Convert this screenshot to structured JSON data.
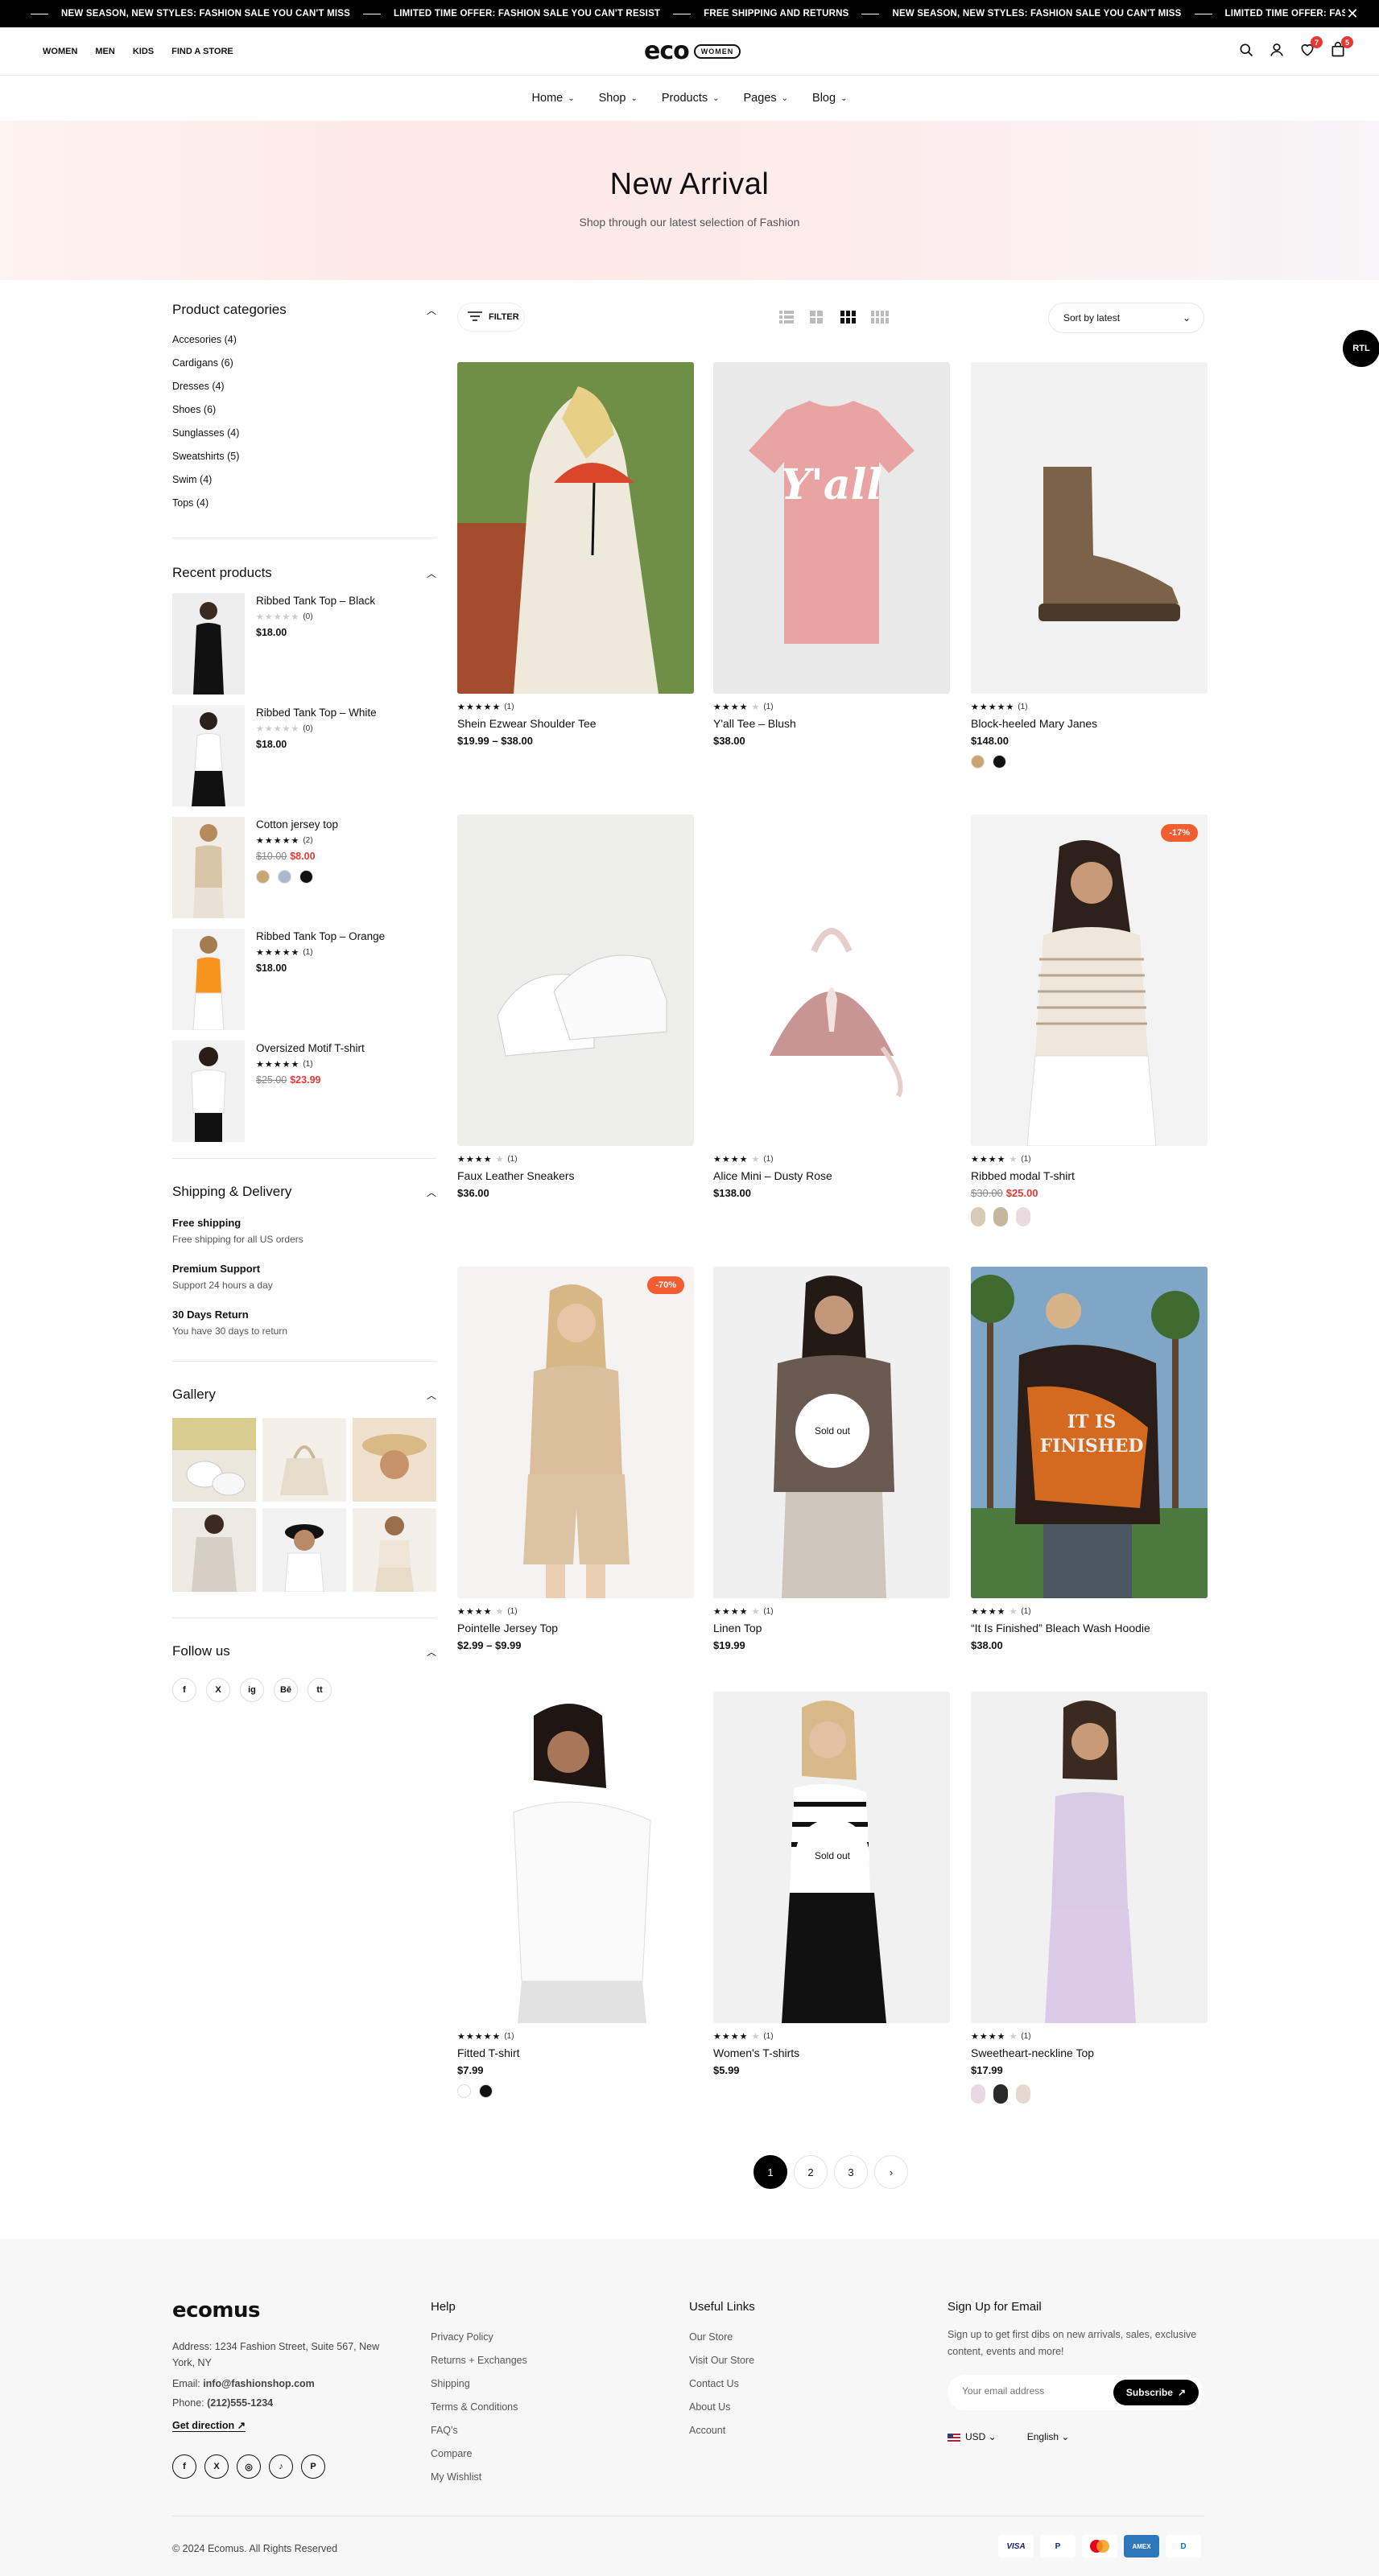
{
  "announcement": {
    "items": [
      "NEW SEASON, NEW STYLES: FASHION SALE YOU CAN'T MISS",
      "LIMITED TIME OFFER: FASHION SALE YOU CAN'T RESIST",
      "FREE SHIPPING AND RETURNS",
      "NEW SEASON, NEW STYLES: FASHION SALE YOU CAN'T MISS",
      "LIMITED TIME OFFER: FASH"
    ]
  },
  "header": {
    "left_links": [
      "WOMEN",
      "MEN",
      "KIDS",
      "FIND A STORE"
    ],
    "logo_text": "eco",
    "logo_pill": "WOMEN",
    "wishlist_count": "7",
    "cart_count": "5"
  },
  "nav": [
    "Home",
    "Shop",
    "Products",
    "Pages",
    "Blog"
  ],
  "hero": {
    "title": "New Arrival",
    "subtitle": "Shop through our latest selection of Fashion"
  },
  "sidebar": {
    "categories_title": "Product categories",
    "categories": [
      "Accesories (4)",
      "Cardigans (6)",
      "Dresses (4)",
      "Shoes (6)",
      "Sunglasses (4)",
      "Sweatshirts (5)",
      "Swim (4)",
      "Tops (4)"
    ],
    "recent_title": "Recent products",
    "recent": [
      {
        "name": "Ribbed Tank Top – Black",
        "count": "(0)",
        "price": "$18.00",
        "rating": 0
      },
      {
        "name": "Ribbed Tank Top – White",
        "count": "(0)",
        "price": "$18.00",
        "rating": 0
      },
      {
        "name": "Cotton jersey top",
        "count": "(2)",
        "old": "$10.00",
        "price": "$8.00",
        "rating": 5
      },
      {
        "name": "Ribbed Tank Top – Orange",
        "count": "(1)",
        "price": "$18.00",
        "rating": 5
      },
      {
        "name": "Oversized Motif T-shirt",
        "count": "(1)",
        "old": "$25.00",
        "price": "$23.99",
        "rating": 5
      }
    ],
    "shipping_title": "Shipping & Delivery",
    "shipping": [
      {
        "title": "Free shipping",
        "desc": "Free shipping for all US orders"
      },
      {
        "title": "Premium Support",
        "desc": "Support 24 hours a day"
      },
      {
        "title": "30 Days Return",
        "desc": "You have 30 days to return"
      }
    ],
    "gallery_title": "Gallery",
    "follow_title": "Follow us",
    "social": [
      "f",
      "X",
      "ig",
      "Bē",
      "tt"
    ]
  },
  "toolbar": {
    "filter_label": "FILTER",
    "sort_label": "Sort by latest",
    "rtl_label": "RTL"
  },
  "products": [
    {
      "name": "Shein Ezwear Shoulder Tee",
      "price": "$19.99 – $38.00",
      "count": "(1)",
      "rating": 5
    },
    {
      "name": "Y'all Tee – Blush",
      "price": "$38.00",
      "count": "(1)",
      "rating": 4
    },
    {
      "name": "Block-heeled Mary Janes",
      "price": "$148.00",
      "count": "(1)",
      "rating": 5
    },
    {
      "name": "Faux Leather Sneakers",
      "price": "$36.00",
      "count": "(1)",
      "rating": 4
    },
    {
      "name": "Alice Mini – Dusty Rose",
      "price": "$138.00",
      "count": "(1)",
      "rating": 4
    },
    {
      "name": "Ribbed modal T-shirt",
      "old": "$30.00",
      "price": "$25.00",
      "count": "(1)",
      "rating": 4,
      "badge": "-17%"
    },
    {
      "name": "Pointelle Jersey Top",
      "price": "$2.99 – $9.99",
      "count": "(1)",
      "rating": 4,
      "badge": "-70%"
    },
    {
      "name": "Linen Top",
      "price": "$19.99",
      "count": "(1)",
      "rating": 4,
      "soldout": "Sold out"
    },
    {
      "name": "“It Is Finished” Bleach Wash Hoodie",
      "price": "$38.00",
      "count": "(1)",
      "rating": 4
    },
    {
      "name": "Fitted T-shirt",
      "price": "$7.99",
      "count": "(1)",
      "rating": 5
    },
    {
      "name": "Women's T-shirts",
      "price": "$5.99",
      "count": "(1)",
      "rating": 4,
      "soldout": "Sold out"
    },
    {
      "name": "Sweetheart-neckline Top",
      "price": "$17.99",
      "count": "(1)",
      "rating": 4
    }
  ],
  "pagination": [
    "1",
    "2",
    "3",
    "›"
  ],
  "footer": {
    "logo": "ecomus",
    "address": "Address: 1234 Fashion Street, Suite 567, New York, NY",
    "email_label": "Email: ",
    "email": "info@fashionshop.com",
    "phone_label": "Phone: ",
    "phone": "(212)555-1234",
    "direction": "Get direction",
    "help_title": "Help",
    "help": [
      "Privacy Policy",
      "Returns + Exchanges",
      "Shipping",
      "Terms & Conditions",
      "FAQ's",
      "Compare",
      "My Wishlist"
    ],
    "links_title": "Useful Links",
    "links": [
      "Our Store",
      "Visit Our Store",
      "Contact Us",
      "About Us",
      "Account"
    ],
    "signup_title": "Sign Up for Email",
    "signup_text": "Sign up to get first dibs on new arrivals, sales, exclusive content, events and more!",
    "email_placeholder": "Your email address",
    "subscribe": "Subscribe",
    "currency": "USD",
    "language": "English",
    "copyright": "© 2024 Ecomus. All Rights Reserved",
    "payments": [
      "VISA",
      "P",
      "MC",
      "AMEX",
      "D"
    ]
  },
  "colors": {
    "accent": "#000000",
    "sale": "#e53935",
    "badge": "#f25d2f",
    "hero_bg": "#fde9e7",
    "footer_bg": "#f7f7f7"
  }
}
